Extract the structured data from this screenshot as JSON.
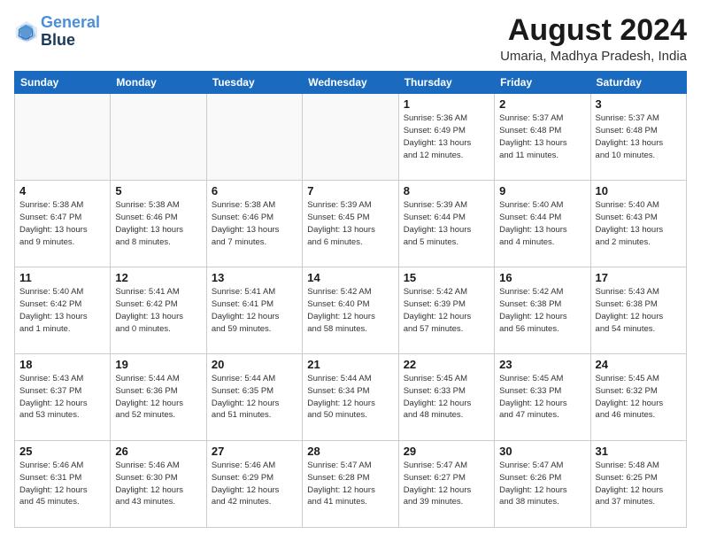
{
  "logo": {
    "line1": "General",
    "line2": "Blue"
  },
  "title": "August 2024",
  "subtitle": "Umaria, Madhya Pradesh, India",
  "days_of_week": [
    "Sunday",
    "Monday",
    "Tuesday",
    "Wednesday",
    "Thursday",
    "Friday",
    "Saturday"
  ],
  "weeks": [
    [
      {
        "day": "",
        "info": ""
      },
      {
        "day": "",
        "info": ""
      },
      {
        "day": "",
        "info": ""
      },
      {
        "day": "",
        "info": ""
      },
      {
        "day": "1",
        "info": "Sunrise: 5:36 AM\nSunset: 6:49 PM\nDaylight: 13 hours\nand 12 minutes."
      },
      {
        "day": "2",
        "info": "Sunrise: 5:37 AM\nSunset: 6:48 PM\nDaylight: 13 hours\nand 11 minutes."
      },
      {
        "day": "3",
        "info": "Sunrise: 5:37 AM\nSunset: 6:48 PM\nDaylight: 13 hours\nand 10 minutes."
      }
    ],
    [
      {
        "day": "4",
        "info": "Sunrise: 5:38 AM\nSunset: 6:47 PM\nDaylight: 13 hours\nand 9 minutes."
      },
      {
        "day": "5",
        "info": "Sunrise: 5:38 AM\nSunset: 6:46 PM\nDaylight: 13 hours\nand 8 minutes."
      },
      {
        "day": "6",
        "info": "Sunrise: 5:38 AM\nSunset: 6:46 PM\nDaylight: 13 hours\nand 7 minutes."
      },
      {
        "day": "7",
        "info": "Sunrise: 5:39 AM\nSunset: 6:45 PM\nDaylight: 13 hours\nand 6 minutes."
      },
      {
        "day": "8",
        "info": "Sunrise: 5:39 AM\nSunset: 6:44 PM\nDaylight: 13 hours\nand 5 minutes."
      },
      {
        "day": "9",
        "info": "Sunrise: 5:40 AM\nSunset: 6:44 PM\nDaylight: 13 hours\nand 4 minutes."
      },
      {
        "day": "10",
        "info": "Sunrise: 5:40 AM\nSunset: 6:43 PM\nDaylight: 13 hours\nand 2 minutes."
      }
    ],
    [
      {
        "day": "11",
        "info": "Sunrise: 5:40 AM\nSunset: 6:42 PM\nDaylight: 13 hours\nand 1 minute."
      },
      {
        "day": "12",
        "info": "Sunrise: 5:41 AM\nSunset: 6:42 PM\nDaylight: 13 hours\nand 0 minutes."
      },
      {
        "day": "13",
        "info": "Sunrise: 5:41 AM\nSunset: 6:41 PM\nDaylight: 12 hours\nand 59 minutes."
      },
      {
        "day": "14",
        "info": "Sunrise: 5:42 AM\nSunset: 6:40 PM\nDaylight: 12 hours\nand 58 minutes."
      },
      {
        "day": "15",
        "info": "Sunrise: 5:42 AM\nSunset: 6:39 PM\nDaylight: 12 hours\nand 57 minutes."
      },
      {
        "day": "16",
        "info": "Sunrise: 5:42 AM\nSunset: 6:38 PM\nDaylight: 12 hours\nand 56 minutes."
      },
      {
        "day": "17",
        "info": "Sunrise: 5:43 AM\nSunset: 6:38 PM\nDaylight: 12 hours\nand 54 minutes."
      }
    ],
    [
      {
        "day": "18",
        "info": "Sunrise: 5:43 AM\nSunset: 6:37 PM\nDaylight: 12 hours\nand 53 minutes."
      },
      {
        "day": "19",
        "info": "Sunrise: 5:44 AM\nSunset: 6:36 PM\nDaylight: 12 hours\nand 52 minutes."
      },
      {
        "day": "20",
        "info": "Sunrise: 5:44 AM\nSunset: 6:35 PM\nDaylight: 12 hours\nand 51 minutes."
      },
      {
        "day": "21",
        "info": "Sunrise: 5:44 AM\nSunset: 6:34 PM\nDaylight: 12 hours\nand 50 minutes."
      },
      {
        "day": "22",
        "info": "Sunrise: 5:45 AM\nSunset: 6:33 PM\nDaylight: 12 hours\nand 48 minutes."
      },
      {
        "day": "23",
        "info": "Sunrise: 5:45 AM\nSunset: 6:33 PM\nDaylight: 12 hours\nand 47 minutes."
      },
      {
        "day": "24",
        "info": "Sunrise: 5:45 AM\nSunset: 6:32 PM\nDaylight: 12 hours\nand 46 minutes."
      }
    ],
    [
      {
        "day": "25",
        "info": "Sunrise: 5:46 AM\nSunset: 6:31 PM\nDaylight: 12 hours\nand 45 minutes."
      },
      {
        "day": "26",
        "info": "Sunrise: 5:46 AM\nSunset: 6:30 PM\nDaylight: 12 hours\nand 43 minutes."
      },
      {
        "day": "27",
        "info": "Sunrise: 5:46 AM\nSunset: 6:29 PM\nDaylight: 12 hours\nand 42 minutes."
      },
      {
        "day": "28",
        "info": "Sunrise: 5:47 AM\nSunset: 6:28 PM\nDaylight: 12 hours\nand 41 minutes."
      },
      {
        "day": "29",
        "info": "Sunrise: 5:47 AM\nSunset: 6:27 PM\nDaylight: 12 hours\nand 39 minutes."
      },
      {
        "day": "30",
        "info": "Sunrise: 5:47 AM\nSunset: 6:26 PM\nDaylight: 12 hours\nand 38 minutes."
      },
      {
        "day": "31",
        "info": "Sunrise: 5:48 AM\nSunset: 6:25 PM\nDaylight: 12 hours\nand 37 minutes."
      }
    ]
  ]
}
